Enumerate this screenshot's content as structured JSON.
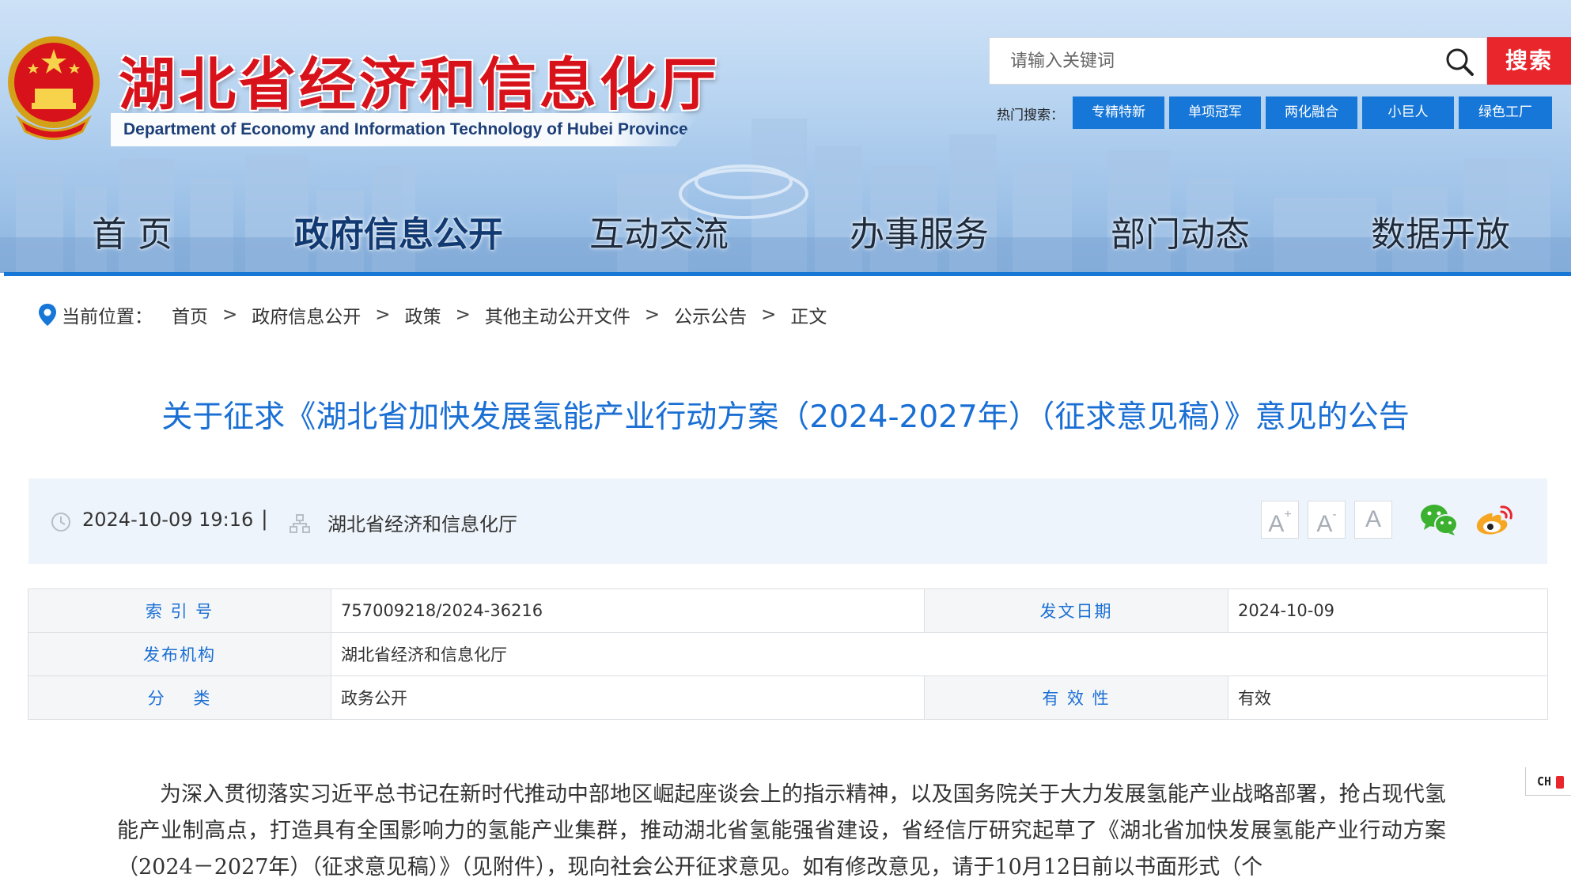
{
  "header": {
    "title": "湖北省经济和信息化厅",
    "subtitle": "Department of Economy and Information Technology of Hubei Province",
    "search": {
      "placeholder": "请输入关键词",
      "button_label": "搜索"
    },
    "hot_search": {
      "label": "热门搜索：",
      "tags": [
        "专精特新",
        "单项冠军",
        "两化融合",
        "小巨人",
        "绿色工厂"
      ]
    },
    "nav": [
      "首 页",
      "政府信息公开",
      "互动交流",
      "办事服务",
      "部门动态",
      "数据开放"
    ],
    "nav_active": "政府信息公开"
  },
  "breadcrumb": {
    "label": "当前位置：",
    "items": [
      "首页",
      "政府信息公开",
      "政策",
      "其他主动公开文件",
      "公示公告",
      "正文"
    ],
    "separator": ">"
  },
  "article": {
    "title": "关于征求《湖北省加快发展氢能产业行动方案（2024-2027年）（征求意见稿）》意见的公告",
    "meta": {
      "datetime": "2024-10-09 19:16",
      "divider": "|",
      "publisher": "湖北省经济和信息化厅"
    },
    "font_sizes": [
      "A+",
      "A-",
      "A"
    ],
    "share": [
      "wechat-icon",
      "weibo-icon"
    ],
    "info": {
      "index_label": "索 引 号",
      "index_value": "757009218/2024-36216",
      "date_label": "发文日期",
      "date_value": "2024-10-09",
      "org_label": "发布机构",
      "org_value": "湖北省经济和信息化厅",
      "category_label": "分    类",
      "category_value": "政务公开",
      "validity_label": "有 效 性",
      "validity_value": "有效"
    },
    "body": "为深入贯彻落实习近平总书记在新时代推动中部地区崛起座谈会上的指示精神，以及国务院关于大力发展氢能产业战略部署，抢占现代氢能产业制高点，打造具有全国影响力的氢能产业集群，推动湖北省氢能强省建设，省经信厅研究起草了《湖北省加快发展氢能产业行动方案（2024－2027年）（征求意见稿）》（见附件），现向社会公开征求意见。如有修改意见，请于10月12日前以书面形式（个"
  },
  "ime_widget": {
    "label": "CH"
  },
  "colors": {
    "brand_red": "#e8262c",
    "title_blue": "#1a6fd4",
    "nav_blue": "#1777d6",
    "tag_blue": "#1677d8"
  }
}
